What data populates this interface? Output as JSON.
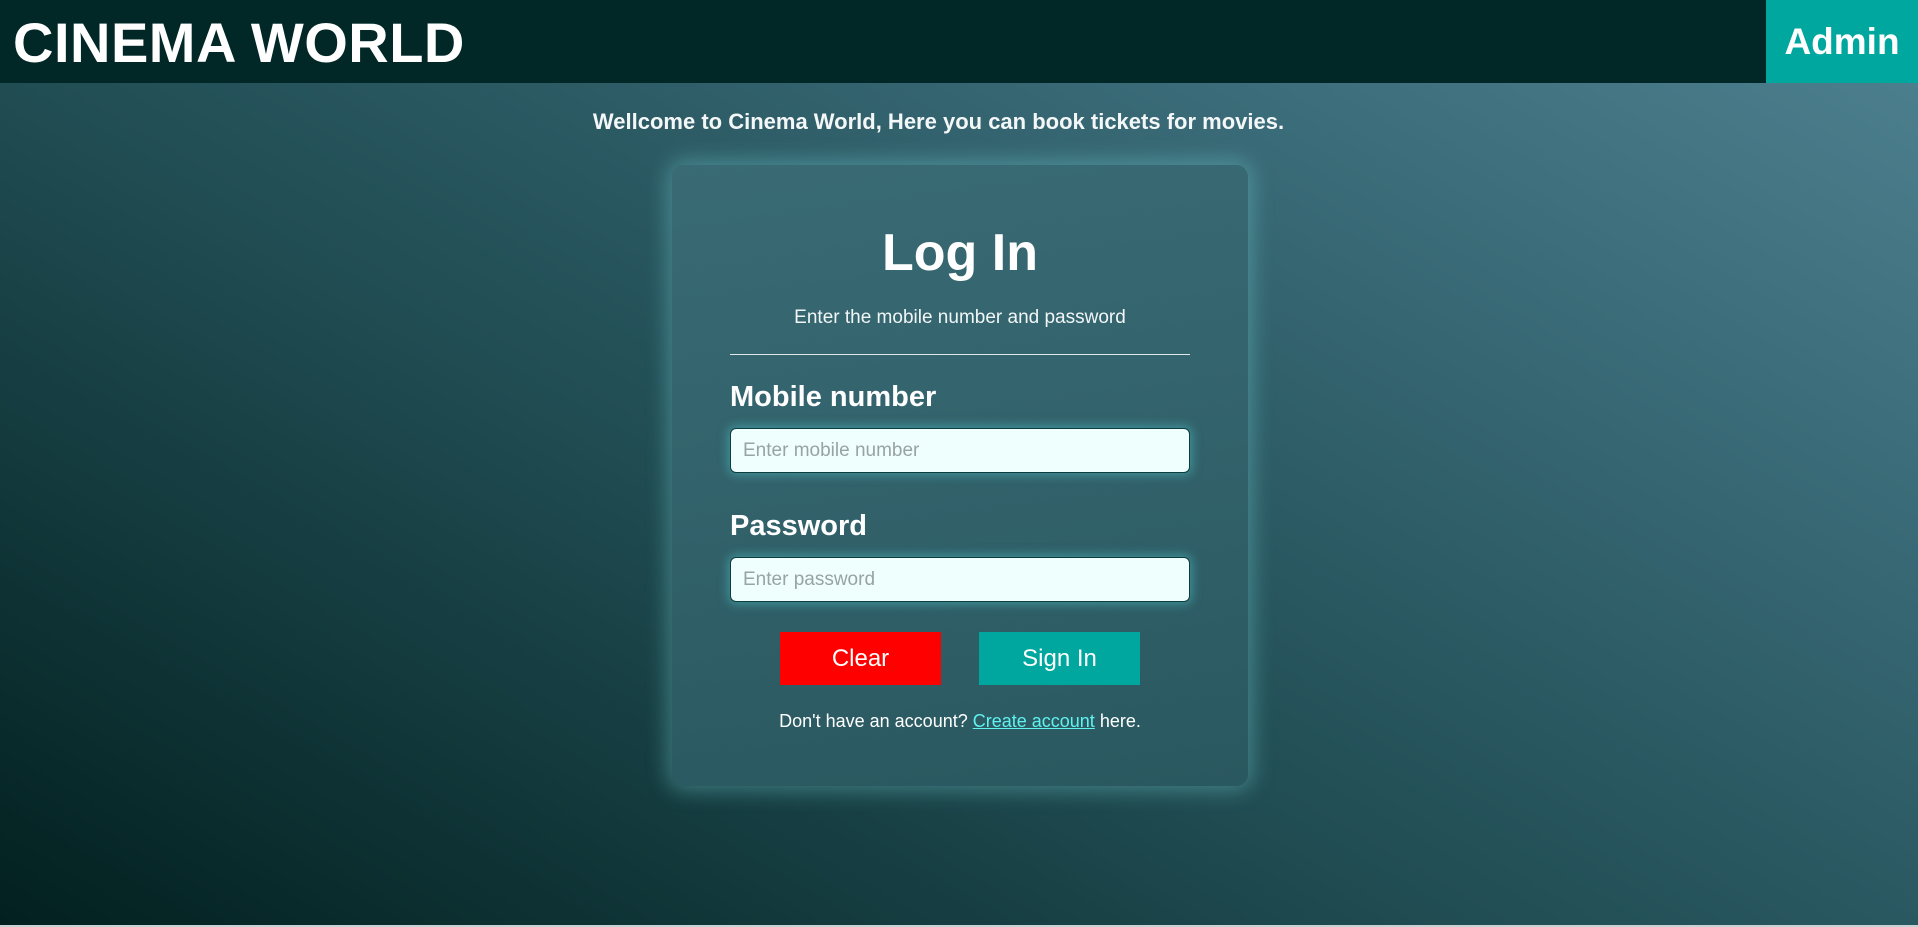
{
  "header": {
    "brand": "CINEMA WORLD",
    "admin_label": "Admin"
  },
  "welcome_text": "Wellcome to Cinema World, Here you can book tickets for movies.",
  "login": {
    "title": "Log In",
    "subtitle": "Enter the mobile number and password",
    "mobile_label": "Mobile number",
    "mobile_placeholder": "Enter mobile number",
    "mobile_value": "",
    "password_label": "Password",
    "password_placeholder": "Enter password",
    "password_value": "",
    "clear_label": "Clear",
    "signin_label": "Sign In",
    "footer_prefix": "Don't have an account? ",
    "footer_link": "Create account",
    "footer_suffix": " here."
  },
  "colors": {
    "header_bg": "#012826",
    "accent": "#00a79e",
    "clear_button": "#ff0000",
    "link": "#5ff3f0"
  }
}
